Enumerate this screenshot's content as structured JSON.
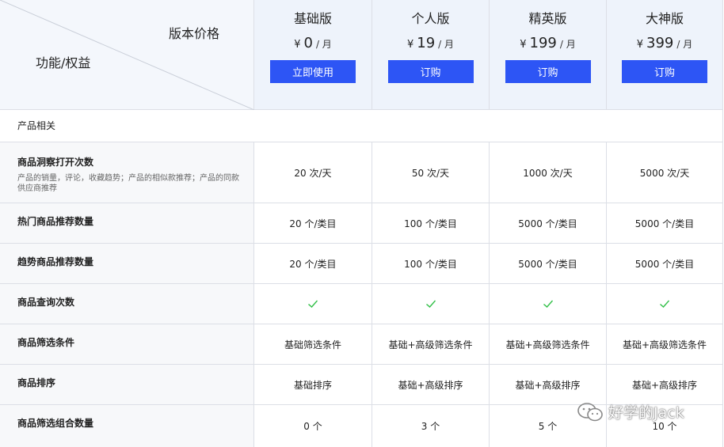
{
  "corner": {
    "top_label": "版本价格",
    "bottom_label": "功能/权益"
  },
  "plans": [
    {
      "name": "基础版",
      "currency": "¥",
      "amount": "0",
      "unit": "/ 月",
      "button": "立即使用"
    },
    {
      "name": "个人版",
      "currency": "¥",
      "amount": "19",
      "unit": "/ 月",
      "button": "订购"
    },
    {
      "name": "精英版",
      "currency": "¥",
      "amount": "199",
      "unit": "/ 月",
      "button": "订购"
    },
    {
      "name": "大神版",
      "currency": "¥",
      "amount": "399",
      "unit": "/ 月",
      "button": "订购"
    }
  ],
  "section": "产品相关",
  "features": [
    {
      "name": "商品洞察打开次数",
      "desc": "产品的销量，评论，收藏趋势；产品的相似款推荐；产品的同款供应商推荐",
      "values": [
        "20 次/天",
        "50 次/天",
        "1000 次/天",
        "5000 次/天"
      ]
    },
    {
      "name": "热门商品推荐数量",
      "values": [
        "20 个/类目",
        "100 个/类目",
        "5000 个/类目",
        "5000 个/类目"
      ]
    },
    {
      "name": "趋势商品推荐数量",
      "values": [
        "20 个/类目",
        "100 个/类目",
        "5000 个/类目",
        "5000 个/类目"
      ]
    },
    {
      "name": "商品查询次数",
      "check": true
    },
    {
      "name": "商品筛选条件",
      "values": [
        "基础筛选条件",
        "基础+高级筛选条件",
        "基础+高级筛选条件",
        "基础+高级筛选条件"
      ]
    },
    {
      "name": "商品排序",
      "values": [
        "基础排序",
        "基础+高级排序",
        "基础+高级排序",
        "基础+高级排序"
      ]
    },
    {
      "name": "商品筛选组合数量",
      "values": [
        "0 个",
        "3 个",
        "5 个",
        "10 个"
      ]
    }
  ],
  "watermark": "好学的Jack",
  "icons": {
    "check": "check-icon",
    "watermark": "wechat-icon"
  },
  "colors": {
    "button": "#2d55f5",
    "check": "#2fbf46",
    "header_bg": "#eef3fb"
  }
}
